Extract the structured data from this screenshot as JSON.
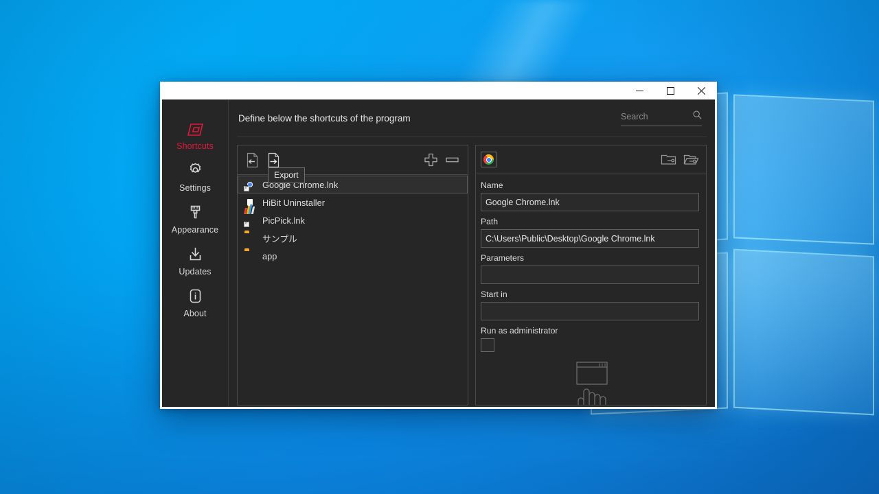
{
  "window": {
    "titlebar": {
      "minimize_label": "Minimize",
      "maximize_label": "Maximize",
      "close_label": "Close"
    }
  },
  "sidebar": {
    "items": [
      {
        "label": "Shortcuts",
        "icon": "shortcuts-icon",
        "active": true
      },
      {
        "label": "Settings",
        "icon": "gear-icon",
        "active": false
      },
      {
        "label": "Appearance",
        "icon": "brush-icon",
        "active": false
      },
      {
        "label": "Updates",
        "icon": "download-icon",
        "active": false
      },
      {
        "label": "About",
        "icon": "info-icon",
        "active": false
      }
    ],
    "active_color": "#e3173b",
    "inactive_color": "#d8d8d8"
  },
  "main": {
    "page_title": "Define below the shortcuts of the program",
    "search": {
      "placeholder": "Search",
      "value": "",
      "icon": "search-icon"
    }
  },
  "list_panel": {
    "toolbar": {
      "import_label": "Import",
      "export_label": "Export",
      "add_label": "Add",
      "remove_label": "Remove"
    },
    "tooltip": {
      "text": "Export"
    },
    "items": [
      {
        "label": "Google Chrome.lnk",
        "icon": "chrome-shortcut-icon",
        "selected": true
      },
      {
        "label": "HiBit Uninstaller",
        "icon": "hibit-icon",
        "selected": false
      },
      {
        "label": "PicPick.lnk",
        "icon": "picpick-icon",
        "selected": false
      },
      {
        "label": "サンプル",
        "icon": "folder-icon",
        "selected": false
      },
      {
        "label": "app",
        "icon": "folder-icon",
        "selected": false
      }
    ]
  },
  "detail_panel": {
    "app_icon": "chrome-icon",
    "browse_file_label": "Browse file",
    "browse_folder_label": "Browse folder",
    "fields": [
      {
        "label": "Name",
        "value": "Google Chrome.lnk"
      },
      {
        "label": "Path",
        "value": "C:\\Users\\Public\\Desktop\\Google Chrome.lnk"
      },
      {
        "label": "Parameters",
        "value": ""
      },
      {
        "label": "Start in",
        "value": ""
      }
    ],
    "run_as_admin": {
      "label": "Run as administrator",
      "checked": false
    },
    "illustration": "window-click-hand-icon"
  }
}
